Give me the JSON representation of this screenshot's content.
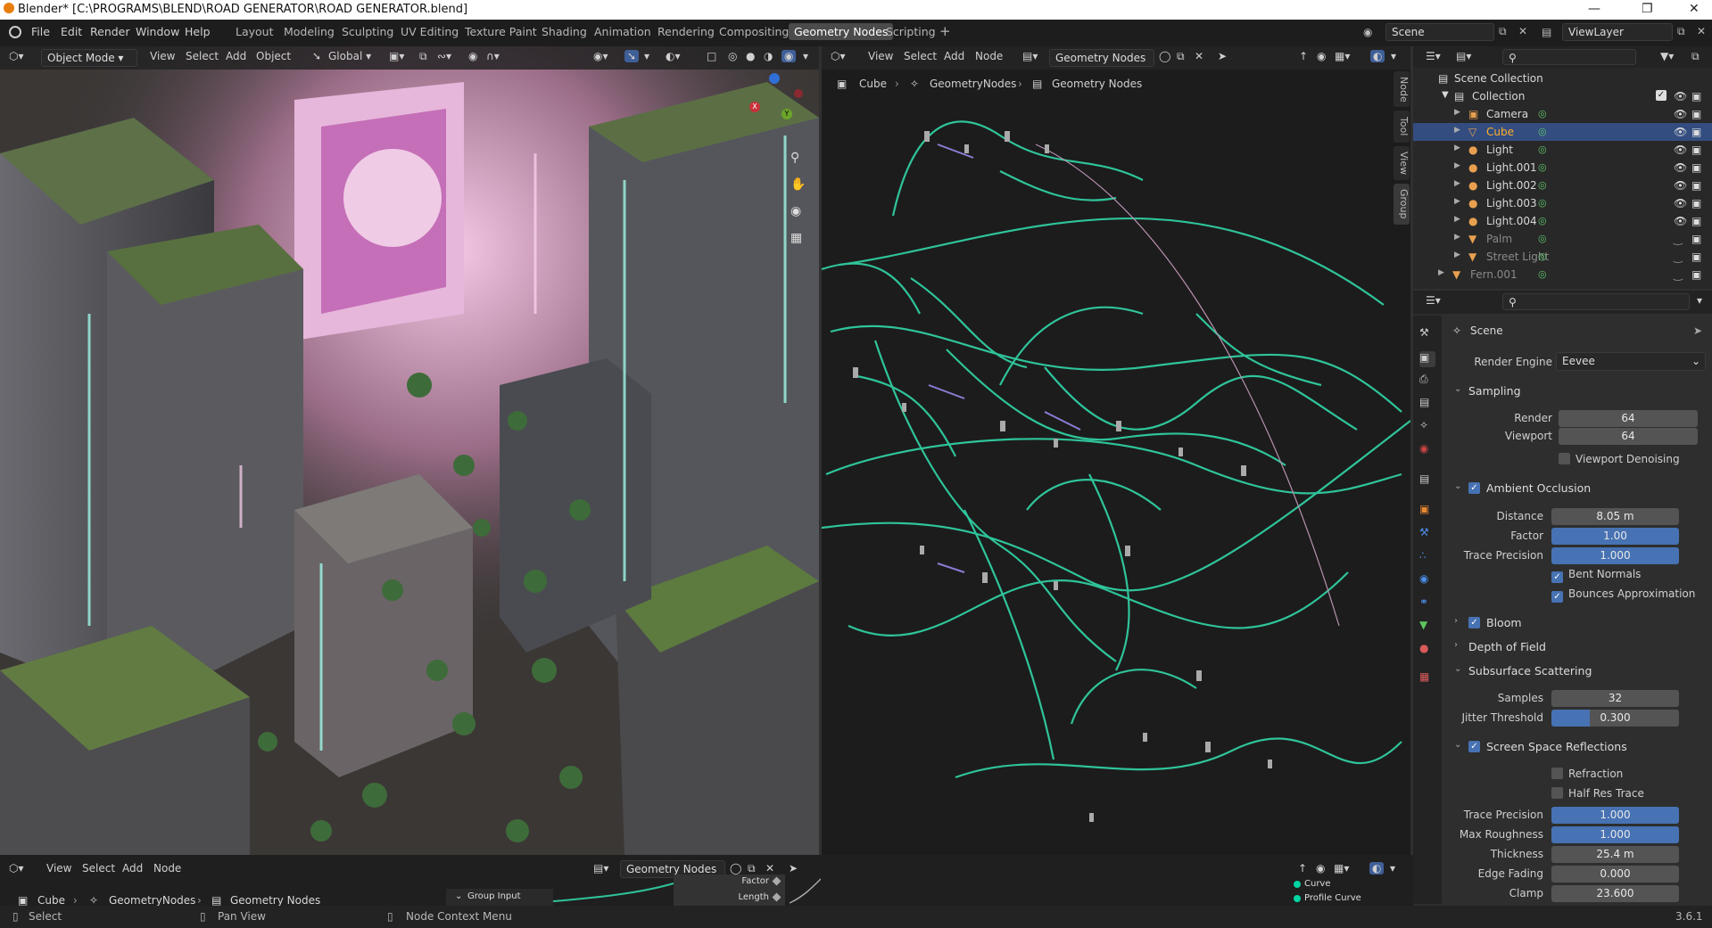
{
  "window": {
    "title": "Blender* [C:\\PROGRAMS\\BLEND\\ROAD GENERATOR\\ROAD GENERATOR.blend]"
  },
  "menu": [
    "File",
    "Edit",
    "Render",
    "Window",
    "Help"
  ],
  "workspaces": [
    "Layout",
    "Modeling",
    "Sculpting",
    "UV Editing",
    "Texture Paint",
    "Shading",
    "Animation",
    "Rendering",
    "Compositing",
    "Geometry Nodes",
    "Scripting"
  ],
  "active_workspace": "Geometry Nodes",
  "scene_field": "Scene",
  "viewlayer_field": "ViewLayer",
  "viewport": {
    "mode": "Object Mode",
    "menu": [
      "View",
      "Select",
      "Add",
      "Object"
    ],
    "orientation": "Global"
  },
  "node_editor": {
    "menu": [
      "View",
      "Select",
      "Add",
      "Node"
    ],
    "tree_name": "Geometry Nodes",
    "breadcrumb": [
      "Cube",
      "GeometryNodes",
      "Geometry Nodes"
    ],
    "side_tabs": [
      "Node",
      "Tool",
      "View",
      "Group"
    ]
  },
  "outliner": {
    "root": "Scene Collection",
    "collection": "Collection",
    "items": [
      {
        "name": "Camera",
        "dim": false
      },
      {
        "name": "Cube",
        "dim": false,
        "selected": true
      },
      {
        "name": "Light",
        "dim": false
      },
      {
        "name": "Light.001",
        "dim": false
      },
      {
        "name": "Light.002",
        "dim": false
      },
      {
        "name": "Light.003",
        "dim": false
      },
      {
        "name": "Light.004",
        "dim": false
      },
      {
        "name": "Palm",
        "dim": true
      },
      {
        "name": "Street Light",
        "dim": true
      },
      {
        "name": "Fern.001",
        "dim": true
      }
    ]
  },
  "properties": {
    "context": "Scene",
    "render_engine_label": "Render Engine",
    "render_engine": "Eevee",
    "sampling": {
      "header": "Sampling",
      "render_label": "Render",
      "render": "64",
      "viewport_label": "Viewport",
      "viewport": "64",
      "denoise_label": "Viewport Denoising"
    },
    "ao": {
      "header": "Ambient Occlusion",
      "distance_label": "Distance",
      "distance": "8.05 m",
      "factor_label": "Factor",
      "factor": "1.00",
      "trace_label": "Trace Precision",
      "trace": "1.000",
      "bent_label": "Bent Normals",
      "bounces_label": "Bounces Approximation"
    },
    "bloom": {
      "header": "Bloom"
    },
    "dof": {
      "header": "Depth of Field"
    },
    "sss": {
      "header": "Subsurface Scattering",
      "samples_label": "Samples",
      "samples": "32",
      "jitter_label": "Jitter Threshold",
      "jitter": "0.300",
      "jitter_fraction": 0.3
    },
    "ssr": {
      "header": "Screen Space Reflections",
      "refraction_label": "Refraction",
      "halfres_label": "Half Res Trace",
      "trace_label": "Trace Precision",
      "trace": "1.000",
      "rough_label": "Max Roughness",
      "rough": "1.000",
      "thick_label": "Thickness",
      "thick": "25.4 m",
      "edge_label": "Edge Fading",
      "edge": "0.000",
      "clamp_label": "Clamp",
      "clamp": "23.600"
    }
  },
  "bottom_editor": {
    "menu": [
      "View",
      "Select",
      "Add",
      "Node"
    ],
    "tree_name": "Geometry Nodes",
    "breadcrumb": [
      "Cube",
      "GeometryNodes",
      "Geometry Nodes"
    ],
    "group_input": "Group Input",
    "sockets_left": [
      "Factor",
      "Length"
    ],
    "sockets_right": [
      "Curve",
      "Profile Curve"
    ]
  },
  "status": {
    "select": "Select",
    "pan": "Pan View",
    "context": "Node Context Menu",
    "version": "3.6.1"
  },
  "colors": {
    "accent": "#4772b3",
    "node_link": "#2fc49a",
    "selected_row": "#334d80"
  }
}
